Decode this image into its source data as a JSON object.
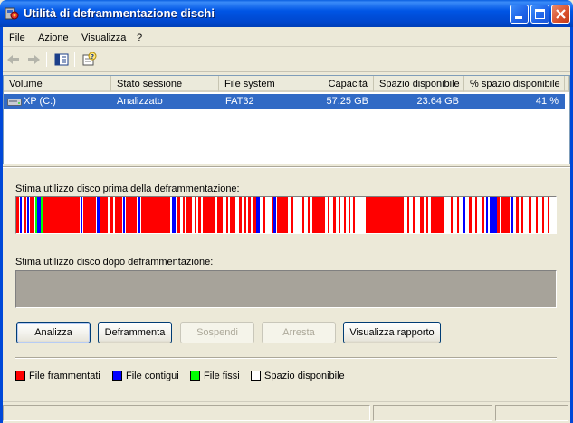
{
  "window": {
    "title": "Utilità di deframmentazione dischi"
  },
  "menu": {
    "items": [
      "File",
      "Azione",
      "Visualizza",
      "?"
    ]
  },
  "table": {
    "columns": [
      "Volume",
      "Stato sessione",
      "File system",
      "Capacità",
      "Spazio disponibile",
      "% spazio disponibile"
    ],
    "rows": [
      {
        "volume": "XP (C:)",
        "status": "Analizzato",
        "fs": "FAT32",
        "capacity": "57.25 GB",
        "free": "23.64 GB",
        "free_pct": "41 %"
      }
    ]
  },
  "before_label": "Stima utilizzo disco prima della deframmentazione:",
  "after_label": "Stima utilizzo disco dopo deframmentazione:",
  "buttons": {
    "analyze": "Analizza",
    "defrag": "Deframmenta",
    "pause": "Sospendi",
    "stop": "Arresta",
    "report": "Visualizza rapporto"
  },
  "legend": {
    "fragmented": "File frammentati",
    "contiguous": "File contigui",
    "fixed": "File fissi",
    "free": "Spazio disponibile"
  },
  "colors": {
    "fragmented": "#FF0000",
    "contiguous": "#0000FF",
    "fixed": "#00FF00",
    "free": "#FFFFFF",
    "after_bar": "#A7A39A",
    "selection": "#316AC5"
  },
  "icons": {
    "app": "defrag-icon",
    "back": "back-arrow-icon",
    "forward": "forward-arrow-icon",
    "panel": "show-hide-panel-icon",
    "help": "help-properties-icon",
    "drive": "hard-drive-icon"
  }
}
